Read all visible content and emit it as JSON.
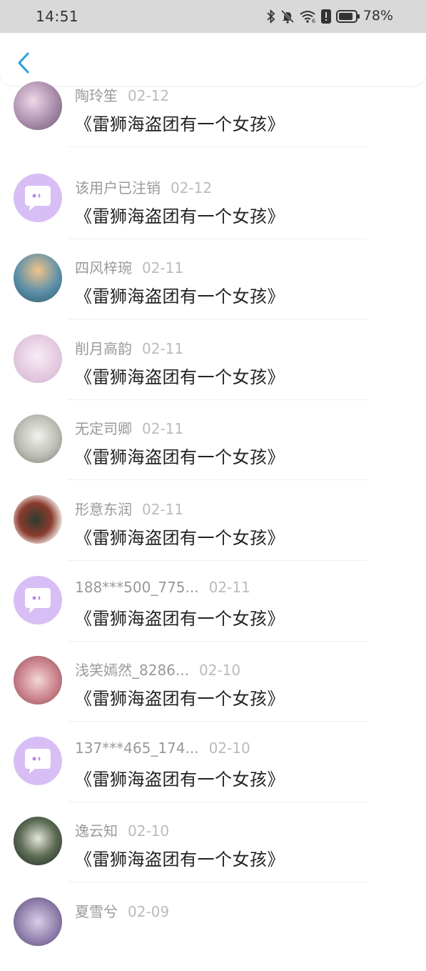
{
  "status": {
    "time": "14:51",
    "battery_pct": "78%",
    "icons": [
      "bluetooth-icon",
      "bell-muted-icon",
      "wifi-icon",
      "alert-icon",
      "battery-icon"
    ]
  },
  "colors": {
    "accent": "#2a9fd8",
    "placeholder_bg": "#d7bff5",
    "placeholder_fg": "#b28be8"
  },
  "items": [
    {
      "name": "陶玲笙",
      "date": "02-12",
      "title": "《雷狮海盗团有一个女孩》",
      "avatar": "photo"
    },
    {
      "name": "该用户已注销",
      "date": "02-12",
      "title": "《雷狮海盗团有一个女孩》",
      "avatar": "default"
    },
    {
      "name": "四风梓琬",
      "date": "02-11",
      "title": "《雷狮海盗团有一个女孩》",
      "avatar": "photo"
    },
    {
      "name": "削月高韵",
      "date": "02-11",
      "title": "《雷狮海盗团有一个女孩》",
      "avatar": "photo"
    },
    {
      "name": "无定司卿",
      "date": "02-11",
      "title": "《雷狮海盗团有一个女孩》",
      "avatar": "photo"
    },
    {
      "name": "形意东润",
      "date": "02-11",
      "title": "《雷狮海盗团有一个女孩》",
      "avatar": "photo"
    },
    {
      "name": "188***500_775...",
      "date": "02-11",
      "title": "《雷狮海盗团有一个女孩》",
      "avatar": "default"
    },
    {
      "name": "浅笑嫣然_8286...",
      "date": "02-10",
      "title": "《雷狮海盗团有一个女孩》",
      "avatar": "photo"
    },
    {
      "name": "137***465_174...",
      "date": "02-10",
      "title": "《雷狮海盗团有一个女孩》",
      "avatar": "default"
    },
    {
      "name": "逸云知",
      "date": "02-10",
      "title": "《雷狮海盗团有一个女孩》",
      "avatar": "photo"
    },
    {
      "name": "夏雪兮",
      "date": "02-09",
      "title": "",
      "avatar": "photo"
    }
  ]
}
